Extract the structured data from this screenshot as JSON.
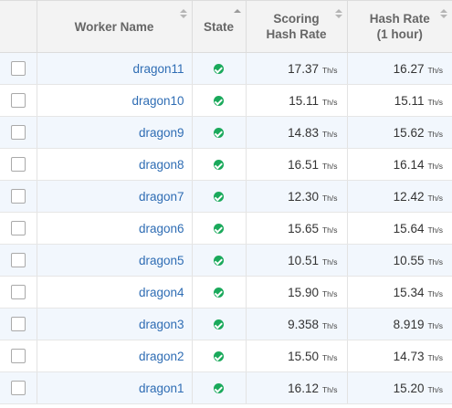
{
  "headers": {
    "worker_name": "Worker Name",
    "state": "State",
    "scoring_line1": "Scoring",
    "scoring_line2": "Hash Rate",
    "hashrate_line1": "Hash Rate",
    "hashrate_line2": "(1 hour)"
  },
  "colors": {
    "link": "#2f6db4",
    "status_ok": "#1aa95b",
    "row_alt": "#f2f7fd"
  },
  "rows": [
    {
      "name": "dragon11",
      "state": "ok",
      "scoring": "17.37",
      "scoring_unit": "Th/s",
      "hashrate": "16.27",
      "hashrate_unit": "Th/s"
    },
    {
      "name": "dragon10",
      "state": "ok",
      "scoring": "15.11",
      "scoring_unit": "Th/s",
      "hashrate": "15.11",
      "hashrate_unit": "Th/s"
    },
    {
      "name": "dragon9",
      "state": "ok",
      "scoring": "14.83",
      "scoring_unit": "Th/s",
      "hashrate": "15.62",
      "hashrate_unit": "Th/s"
    },
    {
      "name": "dragon8",
      "state": "ok",
      "scoring": "16.51",
      "scoring_unit": "Th/s",
      "hashrate": "16.14",
      "hashrate_unit": "Th/s"
    },
    {
      "name": "dragon7",
      "state": "ok",
      "scoring": "12.30",
      "scoring_unit": "Th/s",
      "hashrate": "12.42",
      "hashrate_unit": "Th/s"
    },
    {
      "name": "dragon6",
      "state": "ok",
      "scoring": "15.65",
      "scoring_unit": "Th/s",
      "hashrate": "15.64",
      "hashrate_unit": "Th/s"
    },
    {
      "name": "dragon5",
      "state": "ok",
      "scoring": "10.51",
      "scoring_unit": "Th/s",
      "hashrate": "10.55",
      "hashrate_unit": "Th/s"
    },
    {
      "name": "dragon4",
      "state": "ok",
      "scoring": "15.90",
      "scoring_unit": "Th/s",
      "hashrate": "15.34",
      "hashrate_unit": "Th/s"
    },
    {
      "name": "dragon3",
      "state": "ok",
      "scoring": "9.358",
      "scoring_unit": "Th/s",
      "hashrate": "8.919",
      "hashrate_unit": "Th/s"
    },
    {
      "name": "dragon2",
      "state": "ok",
      "scoring": "15.50",
      "scoring_unit": "Th/s",
      "hashrate": "14.73",
      "hashrate_unit": "Th/s"
    },
    {
      "name": "dragon1",
      "state": "ok",
      "scoring": "16.12",
      "scoring_unit": "Th/s",
      "hashrate": "15.20",
      "hashrate_unit": "Th/s"
    }
  ]
}
